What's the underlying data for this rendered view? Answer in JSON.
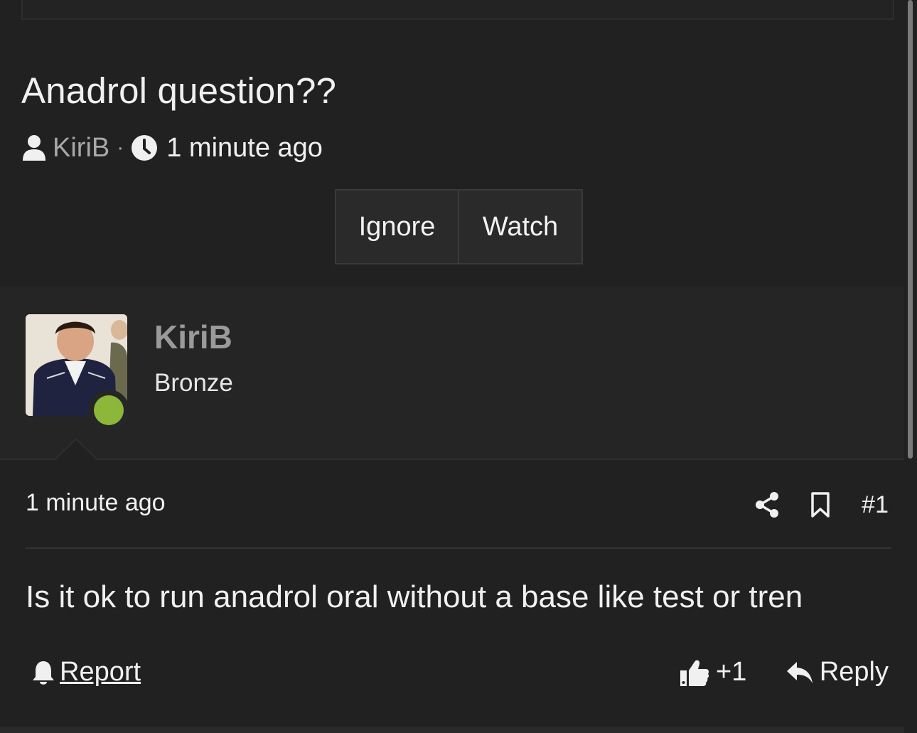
{
  "thread": {
    "title": "Anadrol question??",
    "author": "KiriB",
    "separator": "·",
    "time": "1 minute ago"
  },
  "actions": {
    "ignore_label": "Ignore",
    "watch_label": "Watch"
  },
  "post": {
    "username": "KiriB",
    "rank": "Bronze",
    "online_status": "online",
    "time": "1 minute ago",
    "number": "#1",
    "body": "Is it ok to run anadrol oral without a base like test or tren",
    "report_label": "Report",
    "reaction_count": "+1",
    "reply_label": "Reply"
  },
  "colors": {
    "background": "#212121",
    "online": "#8cb73a",
    "muted_text": "#a8a8a8"
  },
  "icons": [
    "user-icon",
    "clock-icon",
    "share-icon",
    "bookmark-icon",
    "bell-icon",
    "thumbs-up-icon",
    "reply-icon"
  ]
}
